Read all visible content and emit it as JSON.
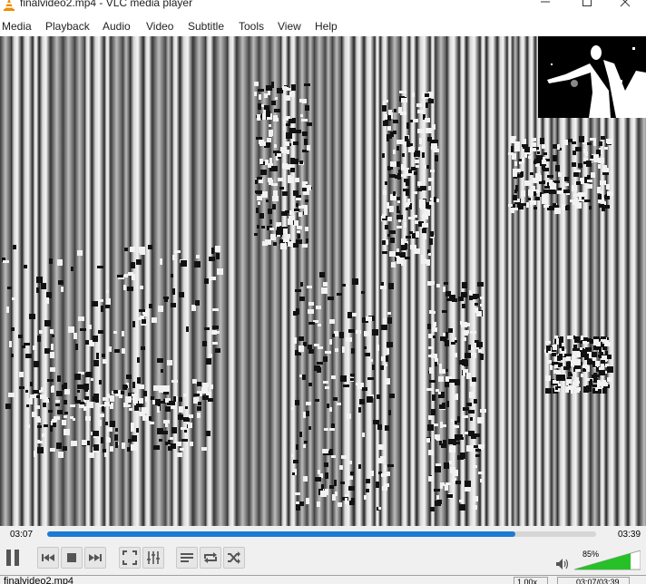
{
  "window": {
    "title": "finalvideo2.mp4 - VLC media player",
    "icons": {
      "app": "vlc-cone-icon",
      "minimize": "minimize-icon",
      "maximize": "maximize-icon",
      "close": "close-icon"
    }
  },
  "menu": {
    "items": [
      "Media",
      "Playback",
      "Audio",
      "Video",
      "Subtitle",
      "Tools",
      "View",
      "Help"
    ]
  },
  "player": {
    "time_elapsed": "03:07",
    "time_total": "03:39",
    "progress": 0.853,
    "volume_label": "85%",
    "volume": 0.85
  },
  "controls": {
    "icons": [
      "pause-icon",
      "previous-icon",
      "stop-icon",
      "next-icon",
      "fullscreen-icon",
      "extended-settings-icon",
      "playlist-icon",
      "loop-icon",
      "shuffle-icon",
      "volume-icon"
    ]
  },
  "status": {
    "filename": "finalvideo2.mp4",
    "speed": "1.00x",
    "time": "03:07/03:39"
  },
  "colors": {
    "accent": "#1c7ad4",
    "volume_green": "#27c027",
    "vlc_orange": "#f08c00"
  }
}
